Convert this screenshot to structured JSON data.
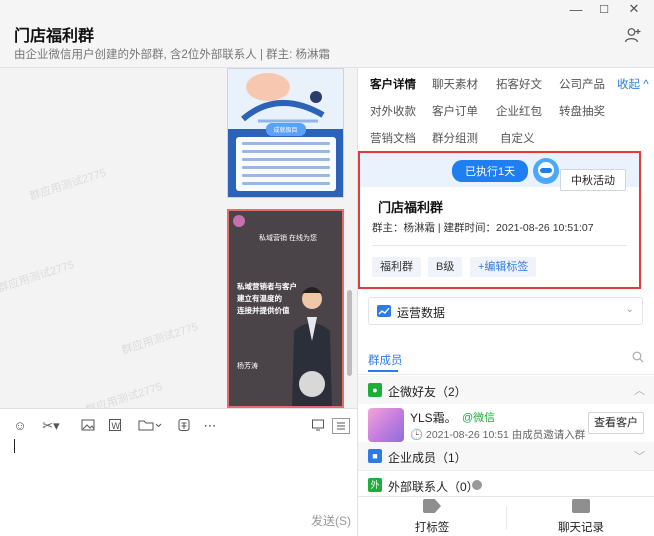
{
  "header": {
    "title": "门店福利群",
    "subtitle": "由企业微信用户创建的外部群, 含2位外部联系人 | 群主: 杨淋霜"
  },
  "window": {
    "minimize": "—",
    "maximize": "☐",
    "close": "✕"
  },
  "chat": {
    "watermark": "群应用测试2775",
    "poster1": {
      "badge": "成就极目"
    },
    "poster2": {
      "line1": "私域营销 在线为您",
      "line2": "私域营销者与客户",
      "line3": "建立有温度的",
      "line4": "连接并提供价值",
      "speaker": "杨芳涛"
    }
  },
  "composer": {
    "send_label": "发送(S)"
  },
  "panel": {
    "tabs": [
      "客户详情",
      "聊天素材",
      "拓客好文",
      "公司产品",
      "对外收款",
      "客户订单",
      "企业红包",
      "转盘抽奖",
      "营销文档",
      "群分组测",
      "自定义"
    ],
    "collapse_label": "收起 ^",
    "card": {
      "exec_badge": "已执行1天",
      "festival": "中秋活动",
      "group_name": "门店福利群",
      "group_info": "群主：杨淋霜 | 建群时间：2021-08-26 10:51:07",
      "tags": [
        "福利群",
        "B级",
        "+编辑标签"
      ]
    },
    "ops_label": "运营数据",
    "members_tab": "群成员",
    "sections": {
      "wechat_friends": "企微好友（2）",
      "enterprise_members": "企业成员（1）",
      "external_contacts": "外部联系人（0）"
    },
    "member": {
      "name": "YLS霜。",
      "source": "@微信",
      "info": "🕒 2021-08-26 10:51 由成员邀请入群",
      "view_button": "查看客户"
    },
    "bottom": {
      "tag_label": "打标签",
      "chat_record_label": "聊天记录"
    }
  },
  "colors": {
    "accent": "#2f7be5",
    "highlight": "#e13b3b",
    "wechat_green": "#1fae3c"
  }
}
